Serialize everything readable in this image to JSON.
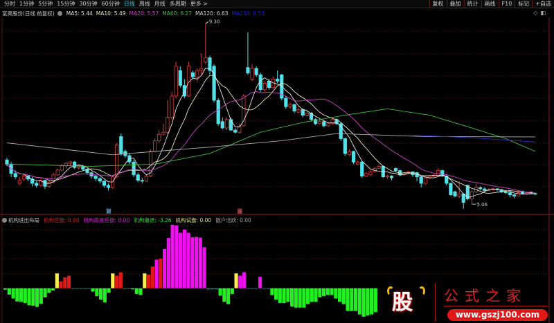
{
  "topbar": {
    "tabs": [
      "分时",
      "1分钟",
      "5分钟",
      "15分钟",
      "30分钟",
      "60分钟",
      "日线",
      "周线",
      "月线",
      "多周期",
      "更多 >"
    ],
    "active_tab": "日线",
    "right_buttons": [
      "复权",
      "叠加",
      "统计",
      "画线",
      "F10",
      "标记",
      "+自选"
    ]
  },
  "info": {
    "title": "富奥股份(日线 前复权)",
    "ma": [
      {
        "label": "MA5: 5.44",
        "color": "#e8e8e8"
      },
      {
        "label": "MA10: 5.49",
        "color": "#e8e8c0"
      },
      {
        "label": "MA20: 5.57",
        "color": "#d040d0"
      },
      {
        "label": "MA60: 6.27",
        "color": "#40c040"
      },
      {
        "label": "MA120: 6.63",
        "color": "#d8d8d8"
      },
      {
        "label": "MA250: 6.53",
        "color": "#2020c0"
      }
    ]
  },
  "markers": {
    "high": "9.30",
    "low": "5.06",
    "event1": "财",
    "event2": "涨"
  },
  "indicator": {
    "title": "机构进出布局",
    "items": [
      {
        "label": "机构控盘: 0.00",
        "color": "#e02020"
      },
      {
        "label": "机构高度控盘: 0.00",
        "color": "#e020e0"
      },
      {
        "label": "机构撤退: -3.26",
        "color": "#30e030"
      },
      {
        "label": "机构试盘: 0.00",
        "color": "#e8e070"
      },
      {
        "label": "散户活跃: 0.00",
        "color": "#a0a0a0"
      }
    ]
  },
  "watermark": {
    "char": "股",
    "name": "公式之家",
    "url": "www.gszj100.com"
  },
  "colors": {
    "up": "#e04040",
    "down": "#54e0e8",
    "grid": "#5a1515"
  },
  "chart_data": [
    {
      "type": "candlestick",
      "ylim": [
        4.9,
        9.5
      ],
      "ohlc": [
        [
          6.1,
          6.15,
          5.95,
          6.0
        ],
        [
          6.0,
          6.05,
          5.7,
          5.78
        ],
        [
          5.78,
          5.85,
          5.65,
          5.7
        ],
        [
          5.55,
          5.7,
          5.5,
          5.62
        ],
        [
          5.65,
          5.78,
          5.6,
          5.72
        ],
        [
          5.72,
          5.75,
          5.6,
          5.65
        ],
        [
          5.65,
          5.7,
          5.48,
          5.55
        ],
        [
          5.55,
          5.6,
          5.45,
          5.5
        ],
        [
          5.5,
          5.66,
          5.48,
          5.62
        ],
        [
          5.62,
          5.64,
          5.42,
          5.48
        ],
        [
          5.48,
          5.62,
          5.45,
          5.58
        ],
        [
          5.58,
          5.8,
          5.55,
          5.75
        ],
        [
          5.75,
          5.9,
          5.72,
          5.86
        ],
        [
          5.86,
          6.0,
          5.82,
          5.96
        ],
        [
          5.96,
          6.05,
          5.9,
          6.02
        ],
        [
          6.02,
          6.08,
          5.95,
          6.05
        ],
        [
          6.05,
          6.08,
          5.88,
          5.92
        ],
        [
          5.92,
          6.0,
          5.88,
          5.95
        ],
        [
          5.95,
          5.98,
          5.85,
          5.88
        ],
        [
          5.88,
          5.9,
          5.75,
          5.8
        ],
        [
          5.8,
          5.82,
          5.66,
          5.72
        ],
        [
          5.72,
          5.75,
          5.6,
          5.66
        ],
        [
          5.66,
          5.7,
          5.55,
          5.6
        ],
        [
          5.6,
          5.62,
          5.45,
          5.5
        ],
        [
          5.5,
          5.55,
          5.38,
          5.45
        ],
        [
          5.45,
          5.75,
          5.42,
          5.7
        ],
        [
          5.7,
          6.5,
          5.68,
          6.45
        ],
        [
          6.65,
          6.72,
          6.2,
          6.25
        ],
        [
          6.3,
          6.35,
          6.15,
          6.2
        ],
        [
          6.2,
          6.25,
          6.0,
          6.05
        ],
        [
          6.05,
          6.1,
          5.7,
          5.75
        ],
        [
          5.75,
          5.8,
          5.58,
          5.62
        ],
        [
          5.62,
          5.68,
          5.55,
          5.6
        ],
        [
          5.6,
          5.75,
          5.58,
          5.72
        ],
        [
          5.72,
          6.35,
          5.7,
          6.3
        ],
        [
          6.3,
          6.6,
          6.28,
          6.55
        ],
        [
          6.55,
          6.8,
          6.5,
          6.7
        ],
        [
          6.7,
          6.95,
          6.68,
          6.75
        ],
        [
          6.75,
          7.5,
          6.7,
          7.1
        ],
        [
          7.1,
          7.7,
          7.05,
          7.6
        ],
        [
          7.6,
          8.4,
          7.55,
          8.3
        ],
        [
          8.2,
          8.3,
          7.8,
          7.85
        ],
        [
          7.85,
          8.0,
          7.55,
          7.6
        ],
        [
          7.6,
          8.4,
          7.58,
          8.3
        ],
        [
          8.15,
          8.2,
          8.0,
          8.05
        ],
        [
          8.05,
          8.25,
          7.95,
          8.2
        ],
        [
          8.2,
          8.6,
          8.1,
          8.25
        ],
        [
          8.4,
          9.3,
          8.35,
          8.5
        ],
        [
          8.5,
          8.55,
          8.1,
          8.2
        ],
        [
          8.3,
          8.35,
          7.45,
          7.5
        ],
        [
          7.5,
          7.55,
          6.9,
          6.95
        ],
        [
          7.0,
          7.1,
          6.82,
          6.85
        ],
        [
          6.85,
          7.1,
          6.8,
          7.05
        ],
        [
          7.05,
          7.1,
          6.78,
          6.8
        ],
        [
          6.8,
          6.85,
          6.72,
          6.75
        ],
        [
          6.75,
          6.95,
          6.72,
          6.9
        ],
        [
          6.9,
          7.65,
          6.88,
          7.6
        ],
        [
          8.27,
          9.1,
          8.1,
          8.14
        ],
        [
          8.0,
          8.35,
          7.95,
          8.25
        ],
        [
          8.25,
          8.3,
          8.05,
          8.1
        ],
        [
          8.1,
          8.15,
          7.7,
          7.75
        ],
        [
          7.75,
          7.95,
          7.7,
          7.9
        ],
        [
          7.95,
          8.0,
          7.75,
          7.8
        ],
        [
          7.8,
          8.05,
          7.78,
          8.0
        ],
        [
          8.0,
          8.2,
          7.9,
          7.95
        ],
        [
          8.1,
          8.12,
          7.5,
          7.55
        ],
        [
          7.55,
          7.6,
          7.3,
          7.35
        ],
        [
          7.35,
          7.45,
          7.3,
          7.4
        ],
        [
          7.4,
          7.42,
          7.2,
          7.25
        ],
        [
          7.22,
          7.32,
          7.2,
          7.28
        ],
        [
          7.28,
          7.3,
          7.1,
          7.15
        ],
        [
          7.15,
          7.25,
          7.12,
          7.2
        ],
        [
          7.2,
          7.22,
          7.0,
          7.05
        ],
        [
          7.05,
          7.08,
          6.92,
          6.95
        ],
        [
          6.95,
          7.05,
          6.93,
          7.0
        ],
        [
          7.0,
          7.02,
          6.86,
          6.9
        ],
        [
          6.9,
          6.98,
          6.88,
          6.95
        ],
        [
          6.95,
          7.1,
          6.92,
          7.05
        ],
        [
          7.05,
          7.08,
          6.92,
          6.95
        ],
        [
          6.95,
          6.98,
          6.55,
          6.6
        ],
        [
          6.6,
          6.62,
          6.2,
          6.25
        ],
        [
          6.22,
          6.35,
          6.2,
          6.3
        ],
        [
          6.3,
          6.32,
          6.0,
          6.05
        ],
        [
          6.0,
          6.08,
          5.98,
          6.05
        ],
        [
          6.05,
          6.07,
          5.68,
          5.72
        ],
        [
          5.72,
          5.82,
          5.7,
          5.78
        ],
        [
          5.75,
          5.85,
          5.72,
          5.82
        ],
        [
          5.82,
          5.93,
          5.8,
          5.9
        ],
        [
          5.9,
          5.98,
          5.88,
          5.95
        ],
        [
          5.95,
          5.97,
          5.68,
          5.7
        ],
        [
          5.7,
          5.75,
          5.65,
          5.72
        ],
        [
          5.72,
          5.74,
          5.62,
          5.68
        ],
        [
          5.9,
          5.92,
          5.82,
          5.85
        ],
        [
          5.85,
          5.87,
          5.72,
          5.75
        ],
        [
          5.75,
          5.82,
          5.73,
          5.8
        ],
        [
          5.8,
          5.84,
          5.78,
          5.82
        ],
        [
          5.82,
          5.83,
          5.7,
          5.75
        ],
        [
          5.8,
          5.82,
          5.6,
          5.7
        ],
        [
          5.7,
          5.72,
          5.45,
          5.55
        ],
        [
          5.55,
          5.7,
          5.52,
          5.68
        ],
        [
          5.68,
          5.74,
          5.65,
          5.72
        ],
        [
          5.72,
          5.76,
          5.7,
          5.74
        ],
        [
          5.74,
          5.9,
          5.72,
          5.85
        ],
        [
          5.85,
          5.87,
          5.7,
          5.72
        ],
        [
          5.72,
          5.74,
          5.5,
          5.55
        ],
        [
          5.55,
          5.57,
          5.25,
          5.28
        ],
        [
          5.35,
          5.38,
          5.22,
          5.25
        ],
        [
          5.25,
          5.6,
          5.2,
          5.3
        ],
        [
          5.3,
          5.32,
          4.95,
          5.1
        ],
        [
          5.5,
          5.52,
          5.15,
          5.18
        ],
        [
          5.18,
          5.4,
          5.06,
          5.35
        ],
        [
          5.35,
          5.55,
          5.32,
          5.45
        ],
        [
          5.45,
          5.48,
          5.38,
          5.42
        ],
        [
          5.42,
          5.46,
          5.35,
          5.38
        ],
        [
          5.38,
          5.44,
          5.36,
          5.4
        ],
        [
          5.4,
          5.45,
          5.38,
          5.42
        ],
        [
          5.42,
          5.44,
          5.36,
          5.4
        ],
        [
          5.4,
          5.42,
          5.32,
          5.35
        ],
        [
          5.35,
          5.37,
          5.3,
          5.33
        ],
        [
          5.33,
          5.35,
          5.22,
          5.28
        ],
        [
          5.28,
          5.3,
          5.2,
          5.25
        ],
        [
          5.25,
          5.36,
          5.24,
          5.33
        ],
        [
          5.36,
          5.38,
          5.28,
          5.3
        ],
        [
          5.3,
          5.34,
          5.28,
          5.32
        ],
        [
          5.34,
          5.36,
          5.29,
          5.31
        ],
        [
          5.31,
          5.33,
          5.27,
          5.3
        ]
      ],
      "ma60": [
        [
          0,
          6.0
        ],
        [
          20,
          5.95
        ],
        [
          35,
          6.0
        ],
        [
          48,
          6.25
        ],
        [
          60,
          6.75
        ],
        [
          70,
          6.98
        ],
        [
          80,
          7.15
        ],
        [
          90,
          7.3
        ],
        [
          100,
          7.15
        ],
        [
          110,
          6.85
        ],
        [
          118,
          6.6
        ],
        [
          125,
          6.3
        ]
      ],
      "ma120": [
        [
          0,
          6.5
        ],
        [
          25,
          6.22
        ],
        [
          48,
          6.4
        ],
        [
          65,
          6.55
        ],
        [
          78,
          6.72
        ],
        [
          98,
          6.65
        ],
        [
          125,
          6.64
        ]
      ],
      "ma250": [
        [
          96,
          6.68
        ],
        [
          110,
          6.62
        ],
        [
          125,
          6.52
        ]
      ],
      "high_index": 47,
      "low_index": 110,
      "event_indices": [
        24,
        55
      ]
    },
    {
      "type": "bar",
      "title": "机构进出布局",
      "values": [
        -0.6,
        -2.8,
        -4.5,
        -5.8,
        -6,
        -6.5,
        -7.5,
        -7.7,
        -8.2,
        -6.8,
        -4,
        -2,
        -1,
        6.5,
        3,
        4.8,
        5.5,
        -0.3,
        -0.3,
        -0.3,
        -0.3,
        -0.3,
        -1.5,
        -3.5,
        -5,
        -6.2,
        -2,
        6.5,
        5.5,
        7,
        -0.3,
        -0.3,
        -0.5,
        -2.5,
        -3,
        6.5,
        6,
        9.5,
        12.5,
        13,
        17.2,
        22,
        27.8,
        27.5,
        24.3,
        25.7,
        24.3,
        22.3,
        22.5,
        22.2,
        18,
        -0.5,
        -0.5,
        -0.5,
        -3.3,
        -6,
        -7,
        -2.5,
        6.5,
        5.5,
        7,
        -0.3,
        -0.3,
        -0.3,
        5,
        -0.3,
        -0.3,
        -3,
        -5,
        -6.5,
        -6.5,
        -6,
        -8,
        -8.5,
        -8.5,
        -8.5,
        -7,
        -6,
        -6,
        -4,
        -3.5,
        -3,
        -3,
        -4.5,
        -6,
        -7,
        -10,
        -10,
        -10,
        -11.5,
        -12.5,
        -12,
        -11.5,
        -10.5
      ],
      "kinds": "ggggggggggggg y rrr ttttt ggggg y rr tt ggg y rr mrmmmmmmmmmmm ttt gggg y mm ttt m tt ggggggggggggggggggggggggggg"
    }
  ]
}
